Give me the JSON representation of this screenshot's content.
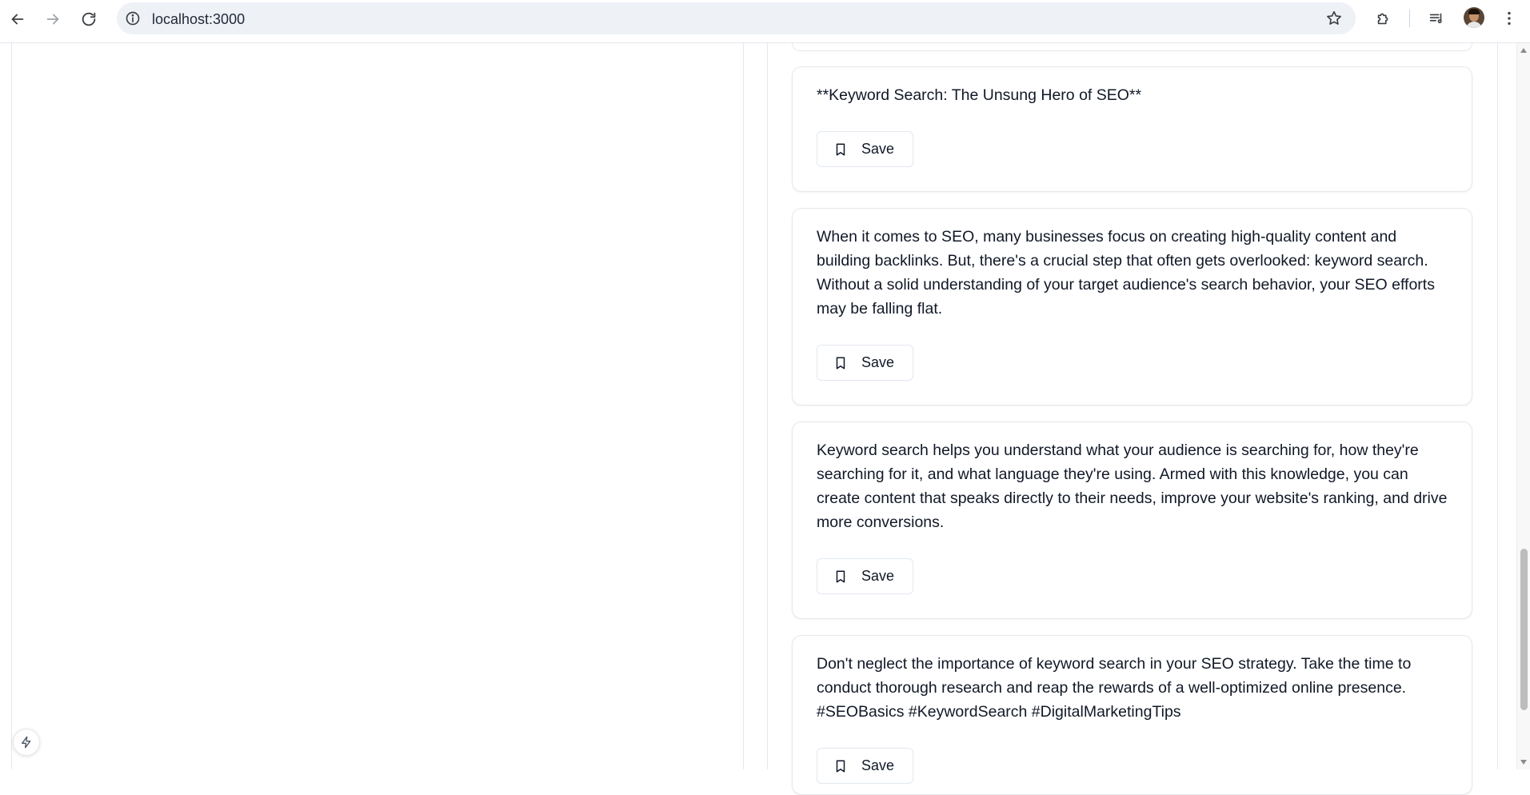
{
  "browser": {
    "url": "localhost:3000"
  },
  "cards": [
    {
      "text": "**Keyword Search: The Unsung Hero of SEO**",
      "save_label": "Save"
    },
    {
      "text": "When it comes to SEO, many businesses focus on creating high-quality content and building backlinks. But, there's a crucial step that often gets overlooked: keyword search. Without a solid understanding of your target audience's search behavior, your SEO efforts may be falling flat.",
      "save_label": "Save"
    },
    {
      "text": "Keyword search helps you understand what your audience is searching for, how they're searching for it, and what language they're using. Armed with this knowledge, you can create content that speaks directly to their needs, improve your website's ranking, and drive more conversions.",
      "save_label": "Save"
    },
    {
      "text": "Don't neglect the importance of keyword search in your SEO strategy. Take the time to conduct thorough research and reap the rewards of a well-optimized online presence. #SEOBasics #KeywordSearch #DigitalMarketingTips",
      "save_label": "Save"
    }
  ],
  "icons": {
    "back": "arrow-left-icon",
    "forward": "arrow-right-icon",
    "reload": "reload-icon",
    "site_info": "info-icon",
    "bookmark_star": "star-icon",
    "extensions": "puzzle-icon",
    "media": "media-queue-icon",
    "menu": "kebab-menu-icon",
    "save": "bookmark-icon",
    "fab": "lightning-icon"
  }
}
